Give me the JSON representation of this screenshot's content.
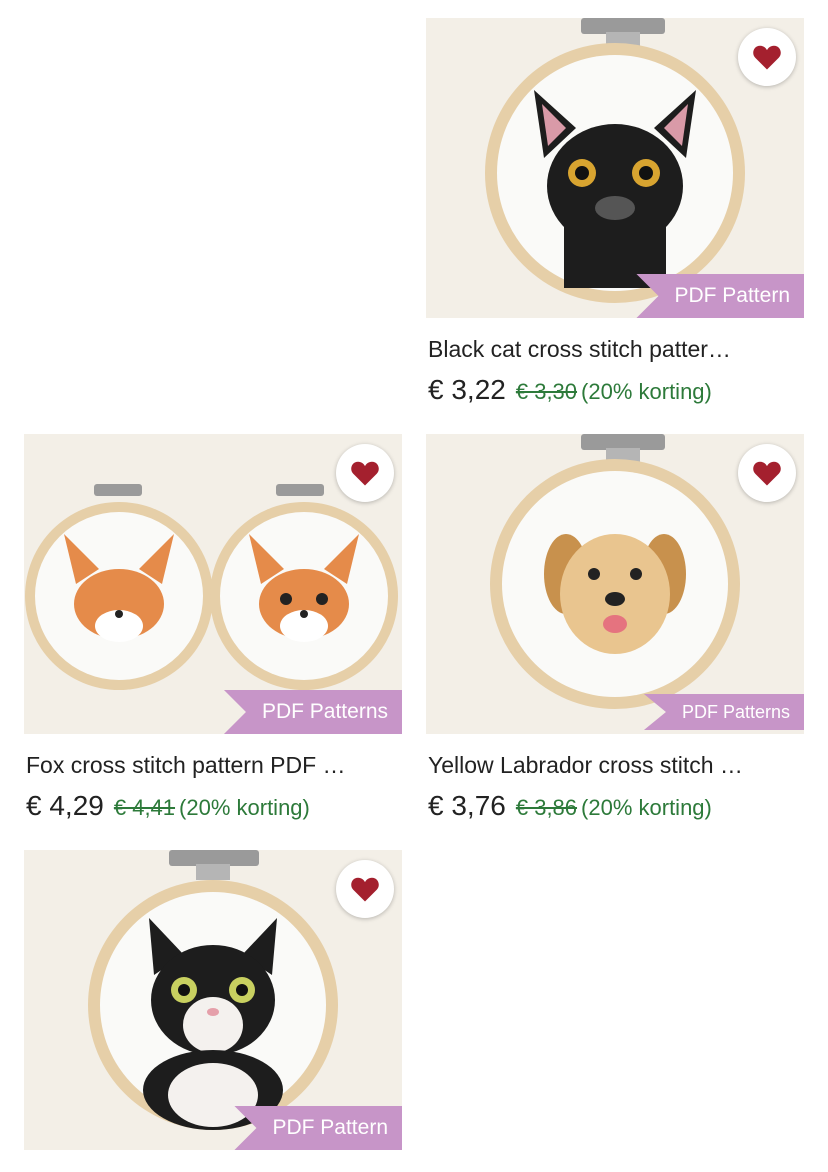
{
  "listings": [
    {
      "title": "Black cat cross stitch patter…",
      "price": "€ 3,22",
      "original_price": "€ 3,30",
      "discount": "(20% korting)",
      "badge": "PDF Pattern",
      "icon": "heart-icon"
    },
    {
      "title": "Fox cross stitch pattern PDF …",
      "price": "€ 4,29",
      "original_price": "€ 4,41",
      "discount": "(20% korting)",
      "badge": "PDF Patterns",
      "icon": "heart-icon"
    },
    {
      "title": "Yellow Labrador cross stitch …",
      "price": "€ 3,76",
      "original_price": "€ 3,86",
      "discount": "(20% korting)",
      "badge": "PDF Patterns",
      "icon": "heart-icon"
    },
    {
      "title": "",
      "badge": "PDF Pattern",
      "icon": "heart-icon"
    }
  ],
  "colors": {
    "favorite_heart": "#a4202e",
    "badge_bg": "#c795c8",
    "discount_text": "#2d7a3a",
    "thumb_bg": "#f3efe7"
  }
}
